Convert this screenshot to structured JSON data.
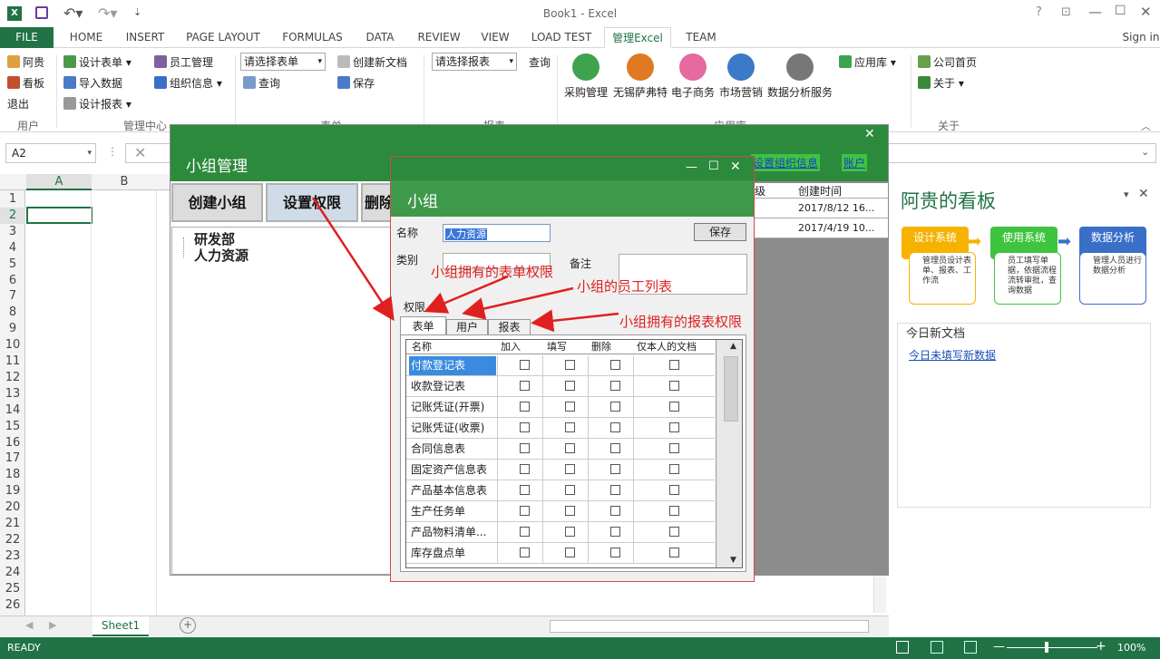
{
  "window": {
    "title": "Book1 - Excel",
    "signin": "Sign in"
  },
  "tabs": [
    "FILE",
    "HOME",
    "INSERT",
    "PAGE LAYOUT",
    "FORMULAS",
    "DATA",
    "REVIEW",
    "VIEW",
    "LOAD TEST",
    "管理Excel",
    "TEAM"
  ],
  "ribbon": {
    "user": {
      "items": [
        "阿贵",
        "看板",
        "退出"
      ],
      "label": "用户"
    },
    "mgmt": {
      "items": [
        "设计表单",
        "导入数据",
        "设计报表",
        "员工管理",
        "组织信息"
      ],
      "label": "管理中心"
    },
    "form": {
      "select_placeholder": "请选择表单",
      "create": "创建新文档",
      "query": "查询",
      "save": "保存",
      "label": "表单"
    },
    "report": {
      "select_placeholder": "请选择报表",
      "query": "查询",
      "label": "报表"
    },
    "apps": {
      "items": [
        "采购管理",
        "无锡萨弗特",
        "电子商务",
        "市场营销",
        "数据分析服务"
      ],
      "store": "应用库",
      "label": "应用库"
    },
    "about": {
      "items": [
        "公司首页",
        "关于"
      ],
      "label": "关于"
    }
  },
  "formula": {
    "namebox": "A2"
  },
  "grid": {
    "columns": [
      "A",
      "B"
    ],
    "rows": [
      "1",
      "2",
      "3",
      "4",
      "5",
      "6",
      "7",
      "8",
      "9",
      "10",
      "11",
      "12",
      "13",
      "14",
      "15",
      "16",
      "17",
      "18",
      "19",
      "20",
      "21",
      "22",
      "23",
      "24",
      "25",
      "26"
    ]
  },
  "sheet": {
    "tab": "Sheet1"
  },
  "status": {
    "text": "READY",
    "zoom": "100%"
  },
  "group_dialog": {
    "title": "小组管理",
    "links": [
      "设置组织信息",
      "账户"
    ],
    "buttons": [
      "创建小组",
      "设置权限",
      "删除"
    ],
    "tree": [
      "研发部",
      "人力资源"
    ],
    "table": {
      "headers": [
        "级",
        "创建时间"
      ],
      "rows": [
        [
          "",
          "2017/8/12  16..."
        ],
        [
          "",
          "2017/4/19  10..."
        ]
      ]
    }
  },
  "team_dialog": {
    "title": "小组",
    "name_label": "名称",
    "name_value": "人力资源",
    "save": "保存",
    "type_label": "类别",
    "note_label": "备注",
    "perm_label": "权限",
    "subtabs": [
      "表单",
      "用户",
      "报表"
    ],
    "columns": [
      "名称",
      "加入",
      "填写",
      "删除",
      "仅本人的文档"
    ],
    "rows": [
      "付款登记表",
      "收款登记表",
      "记账凭证(开票)",
      "记账凭证(收票)",
      "合同信息表",
      "固定资产信息表",
      "产品基本信息表",
      "生产任务单",
      "产品物料清单...",
      "库存盘点单"
    ]
  },
  "annotations": [
    "小组拥有的表单权限",
    "小组的员工列表",
    "小组拥有的报表权限"
  ],
  "kanban": {
    "title": "阿贵的看板",
    "steps": [
      {
        "title": "设计系统",
        "body": "管理员设计表单、报表、工作流",
        "color": "#f5b300"
      },
      {
        "title": "使用系统",
        "body": "员工填写单据，依据流程流转审批，查询数据",
        "color": "#3ec43e"
      },
      {
        "title": "数据分析",
        "body": "管理人员进行数据分析",
        "color": "#3a6fc8"
      }
    ],
    "today_title": "今日新文档",
    "today_link": "今日未填写新数据"
  },
  "colors": {
    "excel_green": "#217346",
    "dialog_green": "#2c8a3c",
    "annotation_red": "#e02020"
  }
}
